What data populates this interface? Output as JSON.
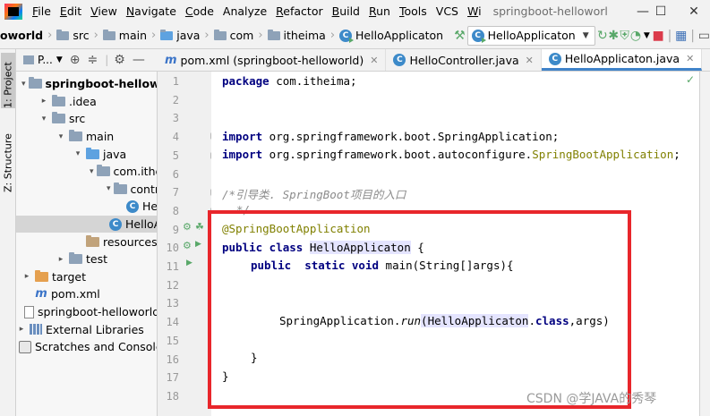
{
  "menu": {
    "items": [
      {
        "mn": "F",
        "rest": "ile"
      },
      {
        "mn": "E",
        "rest": "dit"
      },
      {
        "mn": "V",
        "rest": "iew"
      },
      {
        "mn": "N",
        "rest": "avigate"
      },
      {
        "mn": "C",
        "rest": "ode"
      },
      {
        "mn": "",
        "rest": "Analyze"
      },
      {
        "mn": "R",
        "rest": "efactor"
      },
      {
        "mn": "B",
        "rest": "uild"
      },
      {
        "mn": "R",
        "rest": "un"
      },
      {
        "mn": "T",
        "rest": "ools"
      },
      {
        "mn": "",
        "rest": "VCS"
      },
      {
        "mn": "W",
        "rest": "i"
      }
    ],
    "window_title": "springboot-helloworl"
  },
  "window_controls": {
    "minimize": "—",
    "maximize": "☐",
    "close": "✕"
  },
  "breadcrumb": [
    "oworld",
    "src",
    "main",
    "java",
    "com",
    "itheima",
    "HelloApplicaton"
  ],
  "run_config": {
    "label": "HelloApplicaton"
  },
  "left_strip": {
    "project_tab": "1: Project",
    "structure_tab": "Z: Structure"
  },
  "project_panel": {
    "title": "P..."
  },
  "tree": [
    {
      "label": "springboot-helloworld",
      "depth": 0,
      "toggle": "▾",
      "icon": "folder",
      "bold": true
    },
    {
      "label": ".idea",
      "depth": 1,
      "toggle": "▸",
      "icon": "folder"
    },
    {
      "label": "src",
      "depth": 1,
      "toggle": "▾",
      "icon": "folder"
    },
    {
      "label": "main",
      "depth": 2,
      "toggle": "▾",
      "icon": "folder"
    },
    {
      "label": "java",
      "depth": 3,
      "toggle": "▾",
      "icon": "folder blue"
    },
    {
      "label": "com.itheima",
      "depth": 4,
      "toggle": "▾",
      "icon": "folder"
    },
    {
      "label": "controller",
      "depth": 5,
      "toggle": "▾",
      "icon": "folder"
    },
    {
      "label": "HelloController",
      "depth": 6,
      "toggle": "",
      "icon": "cls"
    },
    {
      "label": "HelloApplicaton",
      "depth": 5,
      "toggle": "",
      "icon": "cls",
      "selected": true
    },
    {
      "label": "resources",
      "depth": 3,
      "toggle": "",
      "icon": "folder brown"
    },
    {
      "label": "test",
      "depth": 2,
      "toggle": "▸",
      "icon": "folder"
    },
    {
      "label": "target",
      "depth": 0,
      "toggle": "▸",
      "icon": "folder orange"
    },
    {
      "label": "pom.xml",
      "depth": 0,
      "toggle": "",
      "icon": "pom"
    },
    {
      "label": "springboot-helloworld.iml",
      "depth": 0,
      "toggle": "",
      "icon": "file"
    },
    {
      "label": "External Libraries",
      "depth": -1,
      "toggle": "▸",
      "icon": "lib"
    },
    {
      "label": "Scratches and Consoles",
      "depth": -1,
      "toggle": "",
      "icon": "scratch"
    }
  ],
  "tabs": [
    {
      "label": "pom.xml (springboot-helloworld)",
      "icon": "m",
      "active": false
    },
    {
      "label": "HelloController.java",
      "icon": "c",
      "active": false
    },
    {
      "label": "HelloApplicaton.java",
      "icon": "c",
      "active": true
    }
  ],
  "line_numbers": [
    "1",
    "2",
    "3",
    "4",
    "5",
    "6",
    "7",
    "8",
    "9",
    "10",
    "11",
    "12",
    "13",
    "14",
    "15",
    "16",
    "17",
    "18"
  ],
  "code": {
    "l1_kw": "package",
    "l1_rest": " com.itheima;",
    "l4_kw": "import",
    "l4_rest": " org.springframework.boot.SpringApplication;",
    "l5_kw": "import",
    "l5_rest": " org.springframework.boot.autoconfigure.",
    "l5_ann": "SpringBootApplication",
    "l5_end": ";",
    "l7": "/*引导类. SpringBoot项目的入口",
    "l8": "*/",
    "l9": "@SpringBootApplication",
    "l10_kw": "public class",
    "l10_sp": " ",
    "l10_cls": "HelloApplicaton",
    "l10_end": " {",
    "l11_kw1": "public",
    "l11_sp": "  ",
    "l11_kw2": "static void",
    "l11_rest": " main(String[]args){",
    "l14_pre": "SpringApplication.",
    "l14_run": "run",
    "l14_paren": "(",
    "l14_cls": "HelloApplicaton",
    "l14_dot": ".",
    "l14_kw": "class",
    "l14_end": ",args)",
    "l16": "}",
    "l17": "}"
  },
  "watermark": "CSDN @学JAVA的秀琴"
}
